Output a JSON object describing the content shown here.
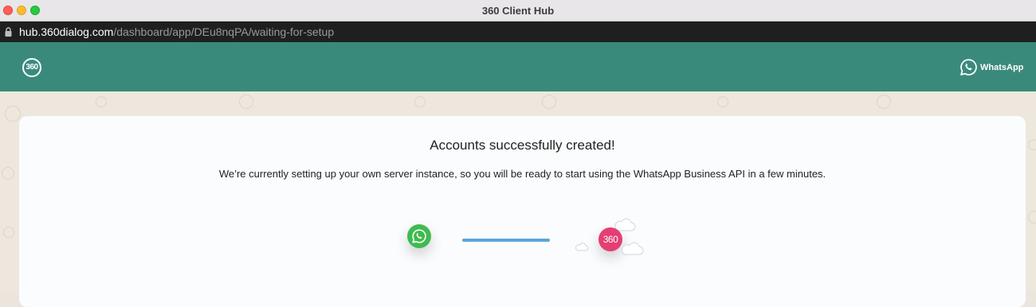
{
  "window": {
    "title": "360 Client Hub"
  },
  "urlbar": {
    "host": "hub.360dialog.com",
    "path": "/dashboard/app/DEu8nqPA/waiting-for-setup"
  },
  "header": {
    "logo_text": "360",
    "brand_label": "WhatsApp"
  },
  "card": {
    "title": "Accounts successfully created!",
    "description": "We’re currently setting up your own server instance, so you will be ready to start using the WhatsApp Business API in a few minutes.",
    "hub_badge_text": "360"
  },
  "colors": {
    "header_bg": "#3a8a7c",
    "whatsapp_green": "#3fbb4f",
    "hub_pink": "#e43e73",
    "progress_blue": "#5ba6d8"
  },
  "icons": [
    "lock-icon",
    "whatsapp-icon",
    "360-logo",
    "cloud-icon"
  ]
}
